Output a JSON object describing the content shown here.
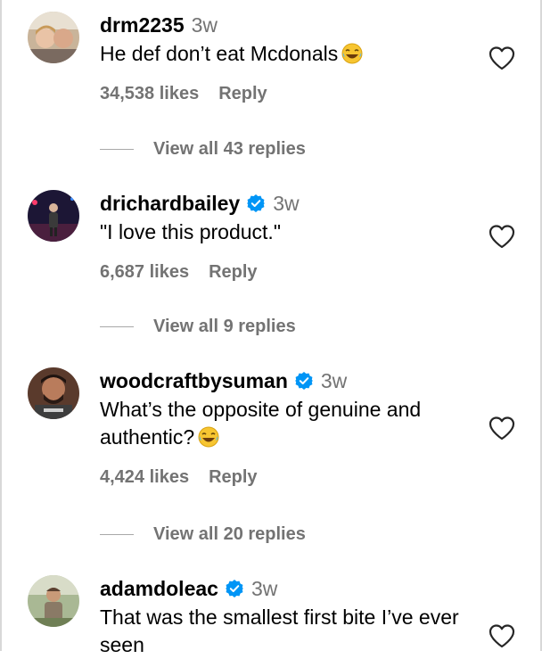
{
  "comments": [
    {
      "username": "drm2235",
      "verified": false,
      "time": "3w",
      "text": "He def don’t eat Mcdonals",
      "emoji": "😂",
      "likes": "34,538 likes",
      "reply": "Reply",
      "view_replies": "View all 43 replies"
    },
    {
      "username": "drichardbailey",
      "verified": true,
      "time": "3w",
      "text": "\"I love this product.\"",
      "likes": "6,687 likes",
      "reply": "Reply",
      "view_replies": "View all 9 replies"
    },
    {
      "username": "woodcraftbysuman",
      "verified": true,
      "time": "3w",
      "text": "What’s the opposite of genuine and authentic?",
      "emoji": "😂",
      "likes": "4,424 likes",
      "reply": "Reply",
      "view_replies": "View all 20 replies"
    },
    {
      "username": "adamdoleac",
      "verified": true,
      "time": "3w",
      "text": "That was the smallest first bite I’ve ever seen"
    }
  ],
  "colors": {
    "muted": "#737373",
    "verified_blue": "#0095f6",
    "divider": "#a8a8a8"
  },
  "icons": {
    "like": "heart-outline-icon",
    "verified": "verified-badge-icon",
    "emoji": "face-with-tears-of-joy"
  }
}
